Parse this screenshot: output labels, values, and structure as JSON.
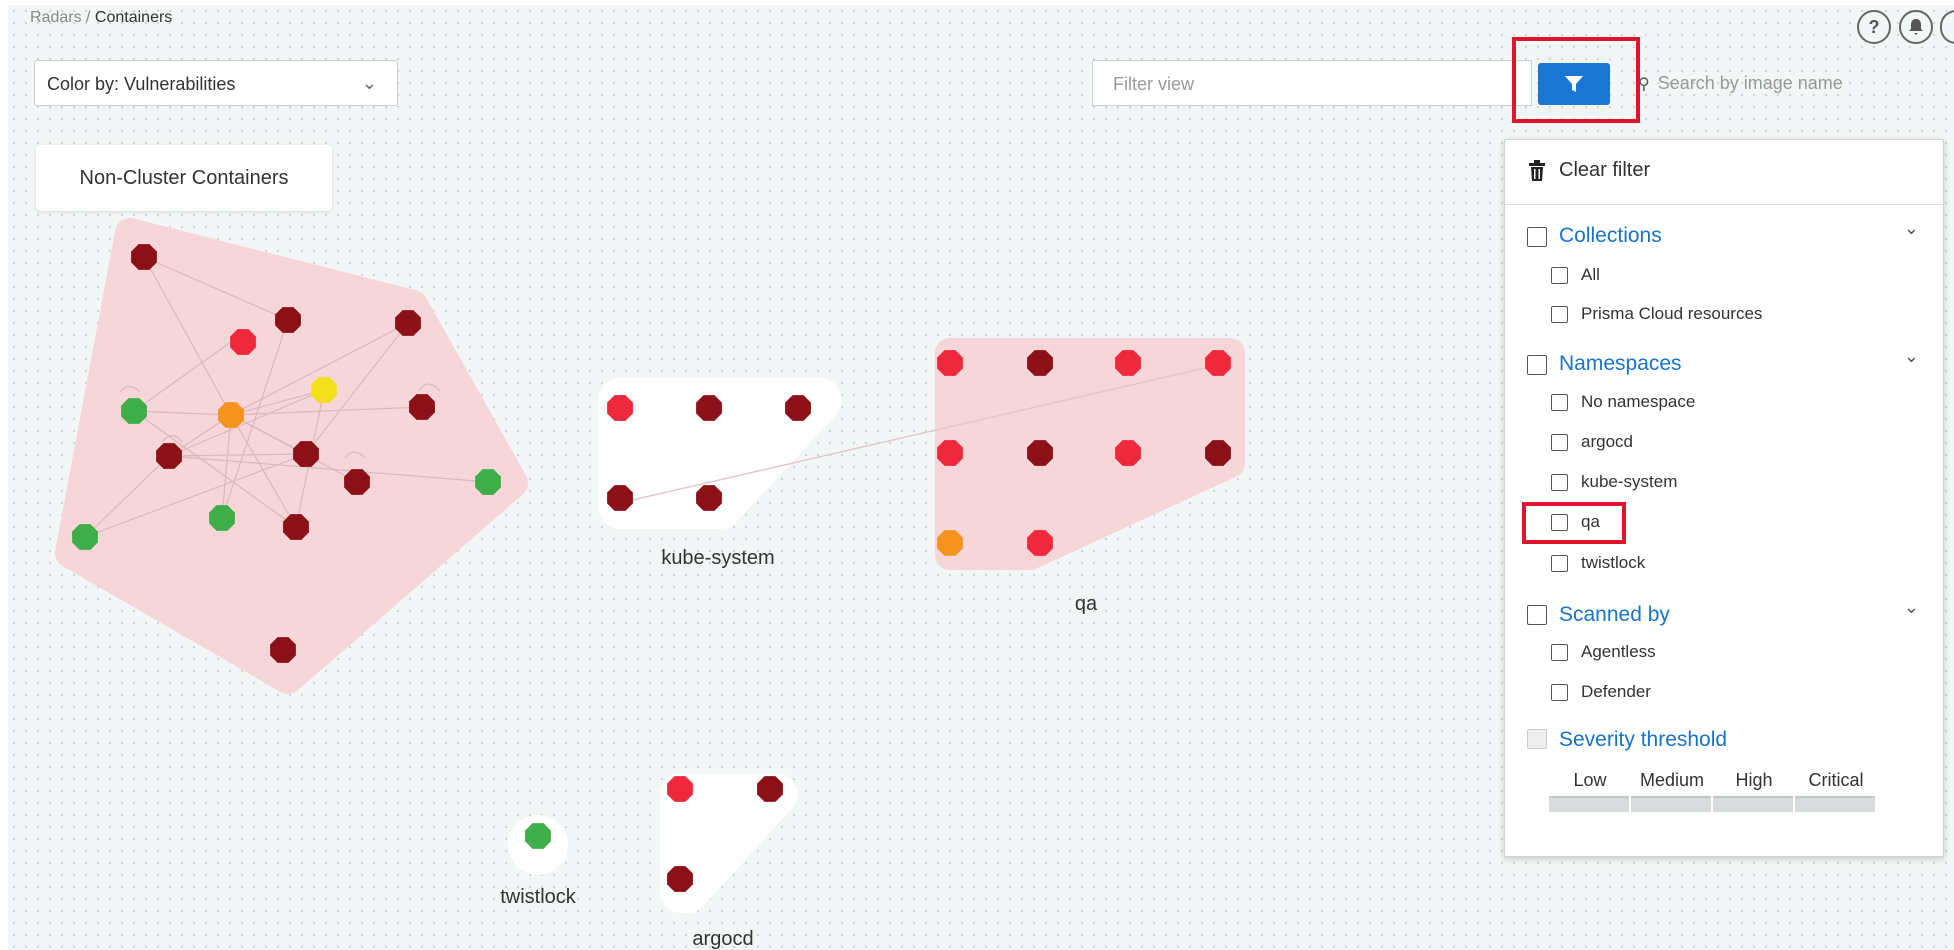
{
  "breadcrumb": {
    "parent": "Radars",
    "separator": " / ",
    "current": "Containers"
  },
  "header": {
    "icons": [
      "help-icon",
      "notifications-icon",
      "account-icon"
    ],
    "help_glyph": "?"
  },
  "color_by": {
    "label": "Color by: Vulnerabilities"
  },
  "filter_view": {
    "placeholder": "Filter view"
  },
  "search": {
    "placeholder": "Search by image name"
  },
  "non_cluster_label": "Non-Cluster Containers",
  "clusters": {
    "kube_system": "kube-system",
    "qa": "qa",
    "twistlock": "twistlock",
    "argocd": "argocd"
  },
  "colors": {
    "critical": "#8b1017",
    "high": "#f0283b",
    "medium": "#f4931e",
    "low": "#f2e01a",
    "ok": "#3fae49",
    "accent": "#1976d2",
    "highlight": "#e0152b"
  },
  "panel": {
    "clear_filter": "Clear filter",
    "collections": {
      "title": "Collections",
      "items": [
        "All",
        "Prisma Cloud resources"
      ]
    },
    "namespaces": {
      "title": "Namespaces",
      "items": [
        "No namespace",
        "argocd",
        "kube-system",
        "qa",
        "twistlock"
      ]
    },
    "scanned_by": {
      "title": "Scanned by",
      "items": [
        "Agentless",
        "Defender"
      ]
    },
    "severity": {
      "title": "Severity threshold",
      "levels": [
        "Low",
        "Medium",
        "High",
        "Critical"
      ]
    }
  }
}
